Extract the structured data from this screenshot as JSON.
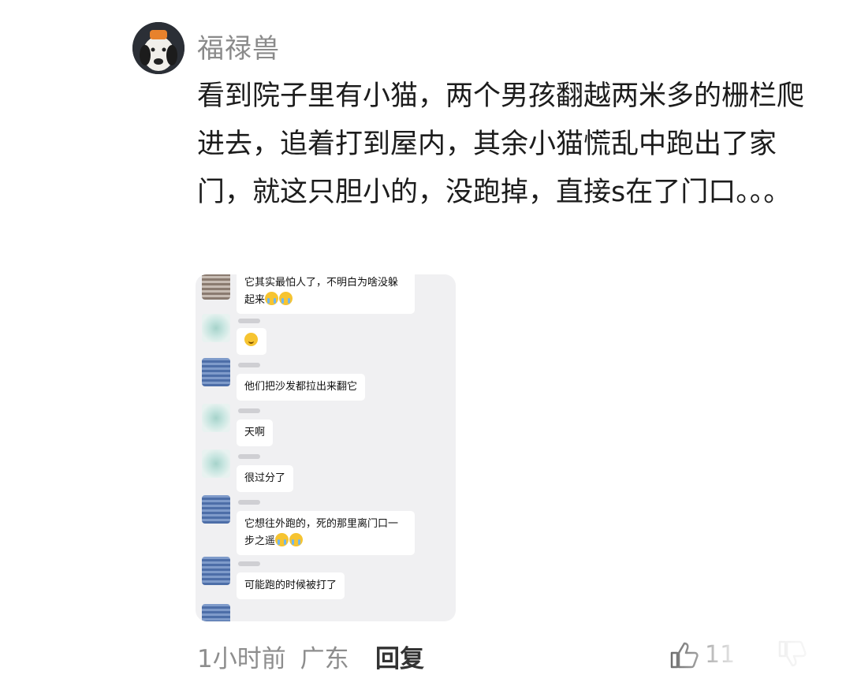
{
  "user": {
    "name": "福禄兽"
  },
  "comment": {
    "text": "看到院子里有小猫，两个男孩翻越两米多的栅栏爬进去，追着打到屋内，其余小猫慌乱中跑出了家门，就这只胆小的，没跑掉，直接s在了门口。。。"
  },
  "chat": {
    "messages": [
      {
        "text": "它其实最怕人了，不明白为啥没躲",
        "text2": "起来",
        "emoji": "cry-cry"
      },
      {
        "text": "",
        "emoji": "smile"
      },
      {
        "text": "他们把沙发都拉出来翻它"
      },
      {
        "text": "天啊"
      },
      {
        "text": "很过分了"
      },
      {
        "text": "它想往外跑的，死的那里离门口一",
        "text2": "步之遥",
        "emoji": "cry-cry"
      },
      {
        "text": "可能跑的时候被打了"
      }
    ]
  },
  "footer": {
    "time": "1小时前",
    "location": "广东",
    "reply_label": "回复",
    "like_count": "11"
  }
}
